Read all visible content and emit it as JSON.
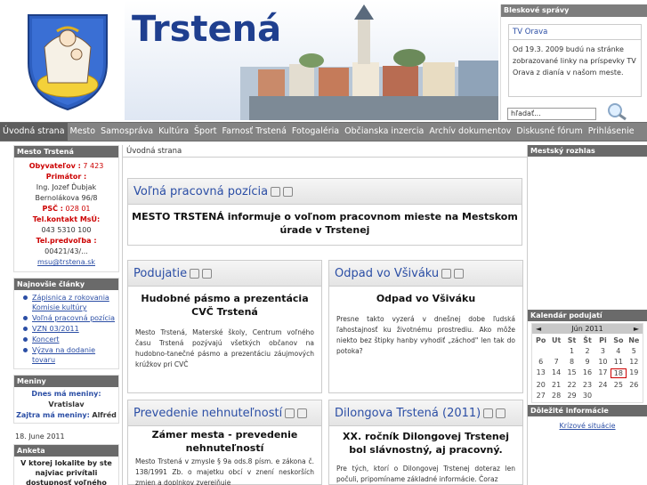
{
  "header": {
    "title": "Trstená",
    "search_placeholder": "hľadať..."
  },
  "flash": {
    "heading": "Bleskové správy",
    "item_title": "TV Orava",
    "item_body": "Od 19.3. 2009 budú na stránke zobrazované linky na príspevky TV Orava z dianía v našom meste."
  },
  "nav": [
    "Úvodná strana",
    "Mesto",
    "Samospráva",
    "Kultúra",
    "Šport",
    "Farnosť Trstená",
    "Fotogaléria",
    "Občianska inzercia",
    "Archív dokumentov",
    "Diskusné fórum",
    "Prihlásenie"
  ],
  "left": {
    "town_heading": "Mesto Trstená",
    "info": [
      {
        "k": "Obyvateľov :",
        "v": "7 423"
      },
      {
        "k": "Primátor :",
        "v": ""
      }
    ],
    "mayor": "Ing. Jozef Ďubjak",
    "address": "Bernolákova 96/8",
    "psc_k": "PSČ :",
    "psc_v": "028 01",
    "tel_k": "Tel.kontakt MsÚ:",
    "tel_v": "043 5310 100",
    "telp_k": "Tel.predvoľba :",
    "telp_v": "00421/43/...",
    "email": "msu@trstena.sk",
    "news_heading": "Najnovšie články",
    "news": [
      "Zápisnica z rokovania Komisie kultúry",
      "Voľná pracovná pozícia",
      "VZN 03/2011",
      "Koncert",
      "Výzva na dodanie tovaru"
    ],
    "names_heading": "Meniny",
    "names_today_k": "Dnes má meniny:",
    "names_today_v": "Vratislav",
    "names_tom_k": "Zajtra má meniny:",
    "names_tom_v": "Alfréd",
    "date": "18. June 2011",
    "poll_heading": "Anketa",
    "poll_q": "V ktorej lokalite by ste najviac privítali dostupnosť voľného"
  },
  "center": {
    "breadcrumb": "Úvodná strana",
    "main": {
      "title": "Voľná pracovná pozícia",
      "head": "MESTO TRSTENÁ  informuje o voľnom pracovnom mieste na Mestskom úrade v Trstenej"
    },
    "c1": {
      "title": "Podujatie",
      "head": "Hudobné pásmo a prezentácia CVČ Trstená",
      "body": "Mesto Trstená, Materské školy, Centrum voľného času Trstená pozývajú všetkých občanov na hudobno-tanečné pásmo a prezentáciu záujmových krúžkov pri CVČ"
    },
    "c2": {
      "title": "Odpad vo Všiváku",
      "head": "Odpad vo Všiváku",
      "body": "Presne takto vyzerá v dnešnej dobe ľudská ľahostajnosť ku životnému prostrediu. Ako môže niekto bez štipky hanby vyhodiť „záchod\" len tak do potoka?"
    },
    "c3": {
      "title": "Prevedenie nehnuteľností",
      "head": "Zámer mesta - prevedenie nehnuteľností",
      "body": "Mesto Trstená v zmysle § 9a ods.8 písm. e zákona č. 138/1991 Zb. o majetku obcí v znení neskorších zmien a doplnkov zverejňuje"
    },
    "c4": {
      "title": "Dilongova Trstená (2011)",
      "head": "XX. ročník Dilongovej Trstenej bol slávnostný, aj pracovný.",
      "body": "Pre tých, ktorí o Dilongovej Trstenej doteraz len počuli, pripomíname základné informácie. Čoraz"
    }
  },
  "right": {
    "radio_heading": "Mestský rozhlas",
    "cal_heading": "Kalendár podujatí",
    "cal_month": "Jún 2011",
    "cal_days": [
      "Po",
      "Ut",
      "St",
      "Št",
      "Pi",
      "So",
      "Ne"
    ],
    "cal_rows": [
      [
        "",
        "",
        "1",
        "2",
        "3",
        "4",
        "5"
      ],
      [
        "6",
        "7",
        "8",
        "9",
        "10",
        "11",
        "12"
      ],
      [
        "13",
        "14",
        "15",
        "16",
        "17",
        "18",
        "19"
      ],
      [
        "20",
        "21",
        "22",
        "23",
        "24",
        "25",
        "26"
      ],
      [
        "27",
        "28",
        "29",
        "30",
        "",
        "",
        ""
      ]
    ],
    "cal_today": "18",
    "cal_prev": "◄",
    "cal_next": "►",
    "important_heading": "Dôležité informácie",
    "important_link": "Krízové situácie"
  }
}
